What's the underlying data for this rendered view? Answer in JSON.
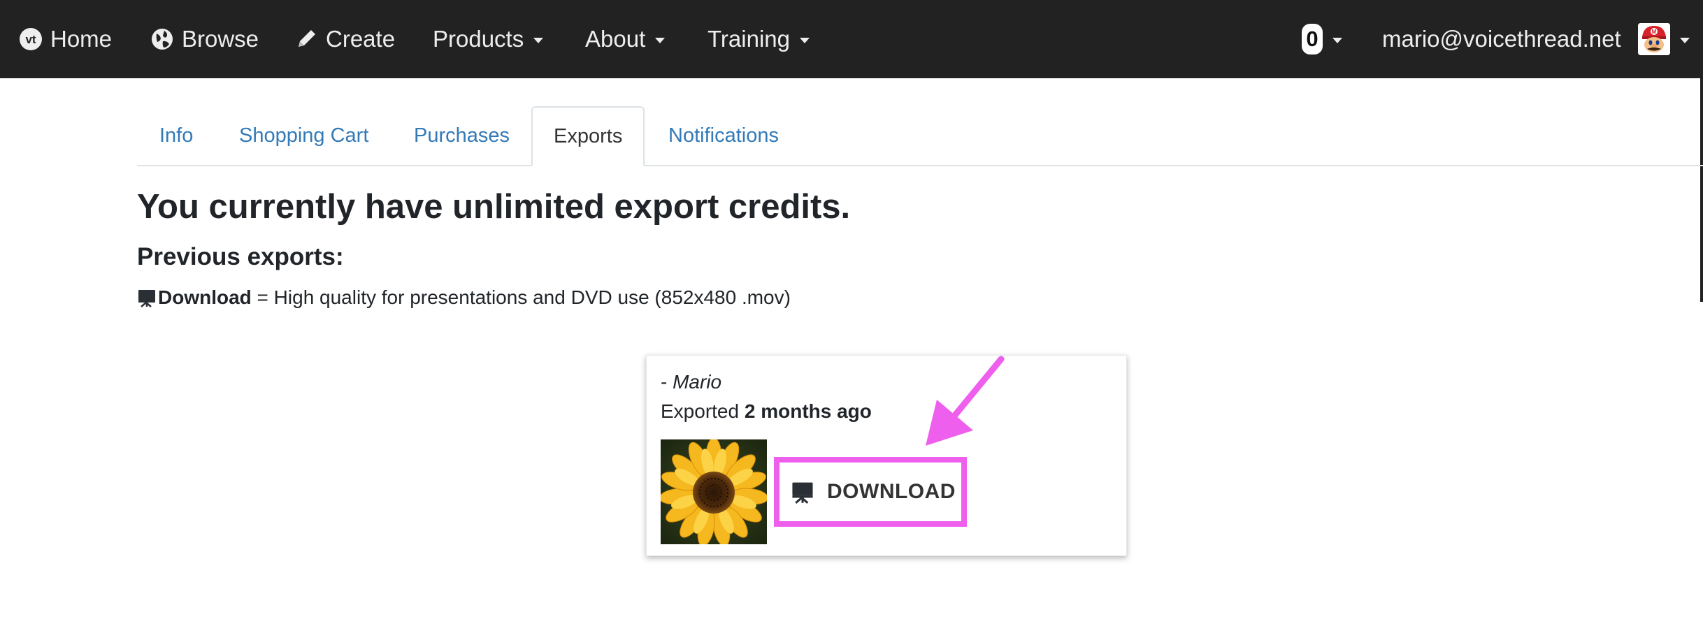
{
  "navbar": {
    "items": [
      {
        "label": "Home",
        "icon": "vt-logo-icon"
      },
      {
        "label": "Browse",
        "icon": "globe-icon"
      },
      {
        "label": "Create",
        "icon": "pencil-icon"
      },
      {
        "label": "Products",
        "dropdown": true
      },
      {
        "label": "About",
        "dropdown": true
      },
      {
        "label": "Training",
        "dropdown": true
      }
    ],
    "credits_badge": "0",
    "user_email": "mario@voicethread.net",
    "avatar_icon": "mario-avatar-icon"
  },
  "tabs": [
    {
      "label": "Info",
      "active": false
    },
    {
      "label": "Shopping Cart",
      "active": false
    },
    {
      "label": "Purchases",
      "active": false
    },
    {
      "label": "Exports",
      "active": true
    },
    {
      "label": "Notifications",
      "active": false
    }
  ],
  "content": {
    "headline": "You currently have unlimited export credits.",
    "subhead": "Previous exports:",
    "legend": {
      "icon": "download-monitor-icon",
      "term": "Download",
      "description": " = High quality for presentations and DVD use (852x480 .mov)"
    }
  },
  "export_card": {
    "author_prefix": "- ",
    "author": "Mario",
    "exported_prefix": "Exported ",
    "exported_when": "2 months ago",
    "thumbnail": "sunflower-thumbnail",
    "download_label": "DOWNLOAD",
    "highlight_color": "#ee5fee"
  },
  "colors": {
    "navbar_bg": "#222222",
    "link": "#337ab7",
    "annotation": "#ee5fee"
  }
}
